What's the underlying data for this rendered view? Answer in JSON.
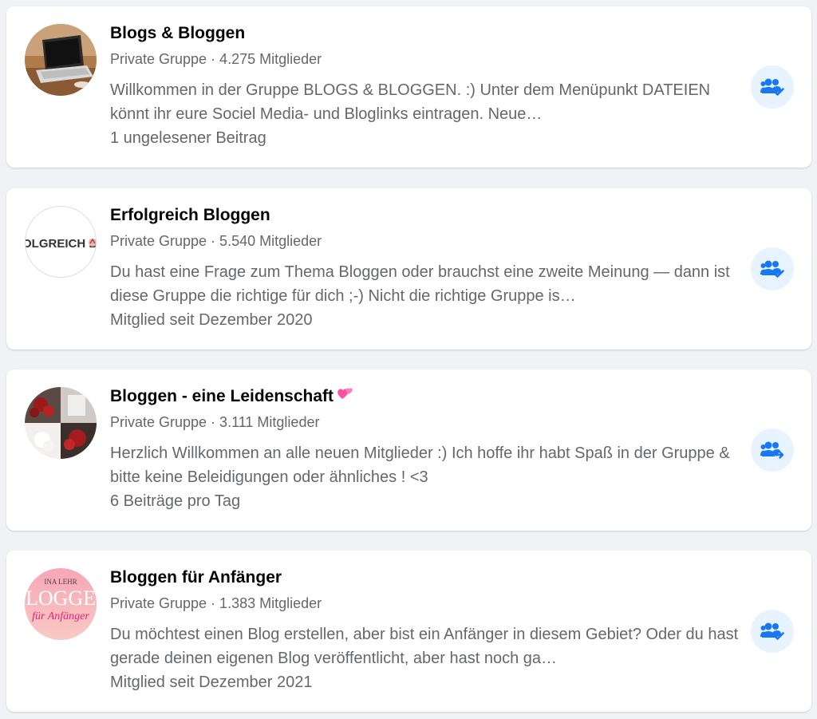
{
  "colors": {
    "background": "#f0f2f5",
    "card": "#ffffff",
    "title": "#050505",
    "secondary_text": "#65676b",
    "action_bg": "#e7f3ff",
    "action_icon": "#1877f2"
  },
  "groups": [
    {
      "name": "Blogs & Bloggen",
      "meta": "Private Gruppe · 4.275 Mitglieder",
      "description": "Willkommen in der Gruppe BLOGS & BLOGGEN. :) Unter dem Menüpunkt DATEIEN könnt ihr eure Sociel Media- und Bloglinks eintragen. Neue…",
      "extra": "1 ungelesener Beitrag",
      "avatar_icon": "laptop-photo",
      "action_icon": "group-joined-icon"
    },
    {
      "name": "Erfolgreich Bloggen",
      "meta": "Private Gruppe · 5.540 Mitglieder",
      "description": "Du hast eine Frage zum Thema Bloggen oder brauchst eine zweite Meinung — dann ist diese Gruppe die richtige für dich ;-) Nicht die richtige Gruppe is…",
      "extra": "Mitglied seit Dezember 2020",
      "avatar_text": "OLGREICH BL",
      "avatar_icon": "logo-text",
      "action_icon": "group-joined-icon"
    },
    {
      "name": "Bloggen - eine Leidenschaft",
      "title_emoji": "two-hearts",
      "meta": "Private Gruppe · 3.111 Mitglieder",
      "description": "Herzlich Willkommen an alle neuen Mitglieder :) Ich hoffe ihr habt Spaß in der Gruppe & bitte keine Beleidigungen oder ähnliches ! <3",
      "extra": "6 Beiträge pro Tag",
      "avatar_icon": "roses-photo",
      "action_icon": "group-share-icon"
    },
    {
      "name": "Bloggen für Anfänger",
      "meta": "Private Gruppe · 1.383 Mitglieder",
      "description": "Du möchtest einen Blog erstellen, aber bist ein Anfänger in diesem Gebiet? Oder du hast gerade deinen eigenen Blog veröffentlicht, aber hast noch ga…",
      "extra": "Mitglied seit Dezember 2021",
      "avatar_line1": "INA LEHR",
      "avatar_line2": "LOGGE",
      "avatar_line3": "für Anfänger",
      "avatar_icon": "logo-pink",
      "action_icon": "group-joined-icon"
    }
  ]
}
